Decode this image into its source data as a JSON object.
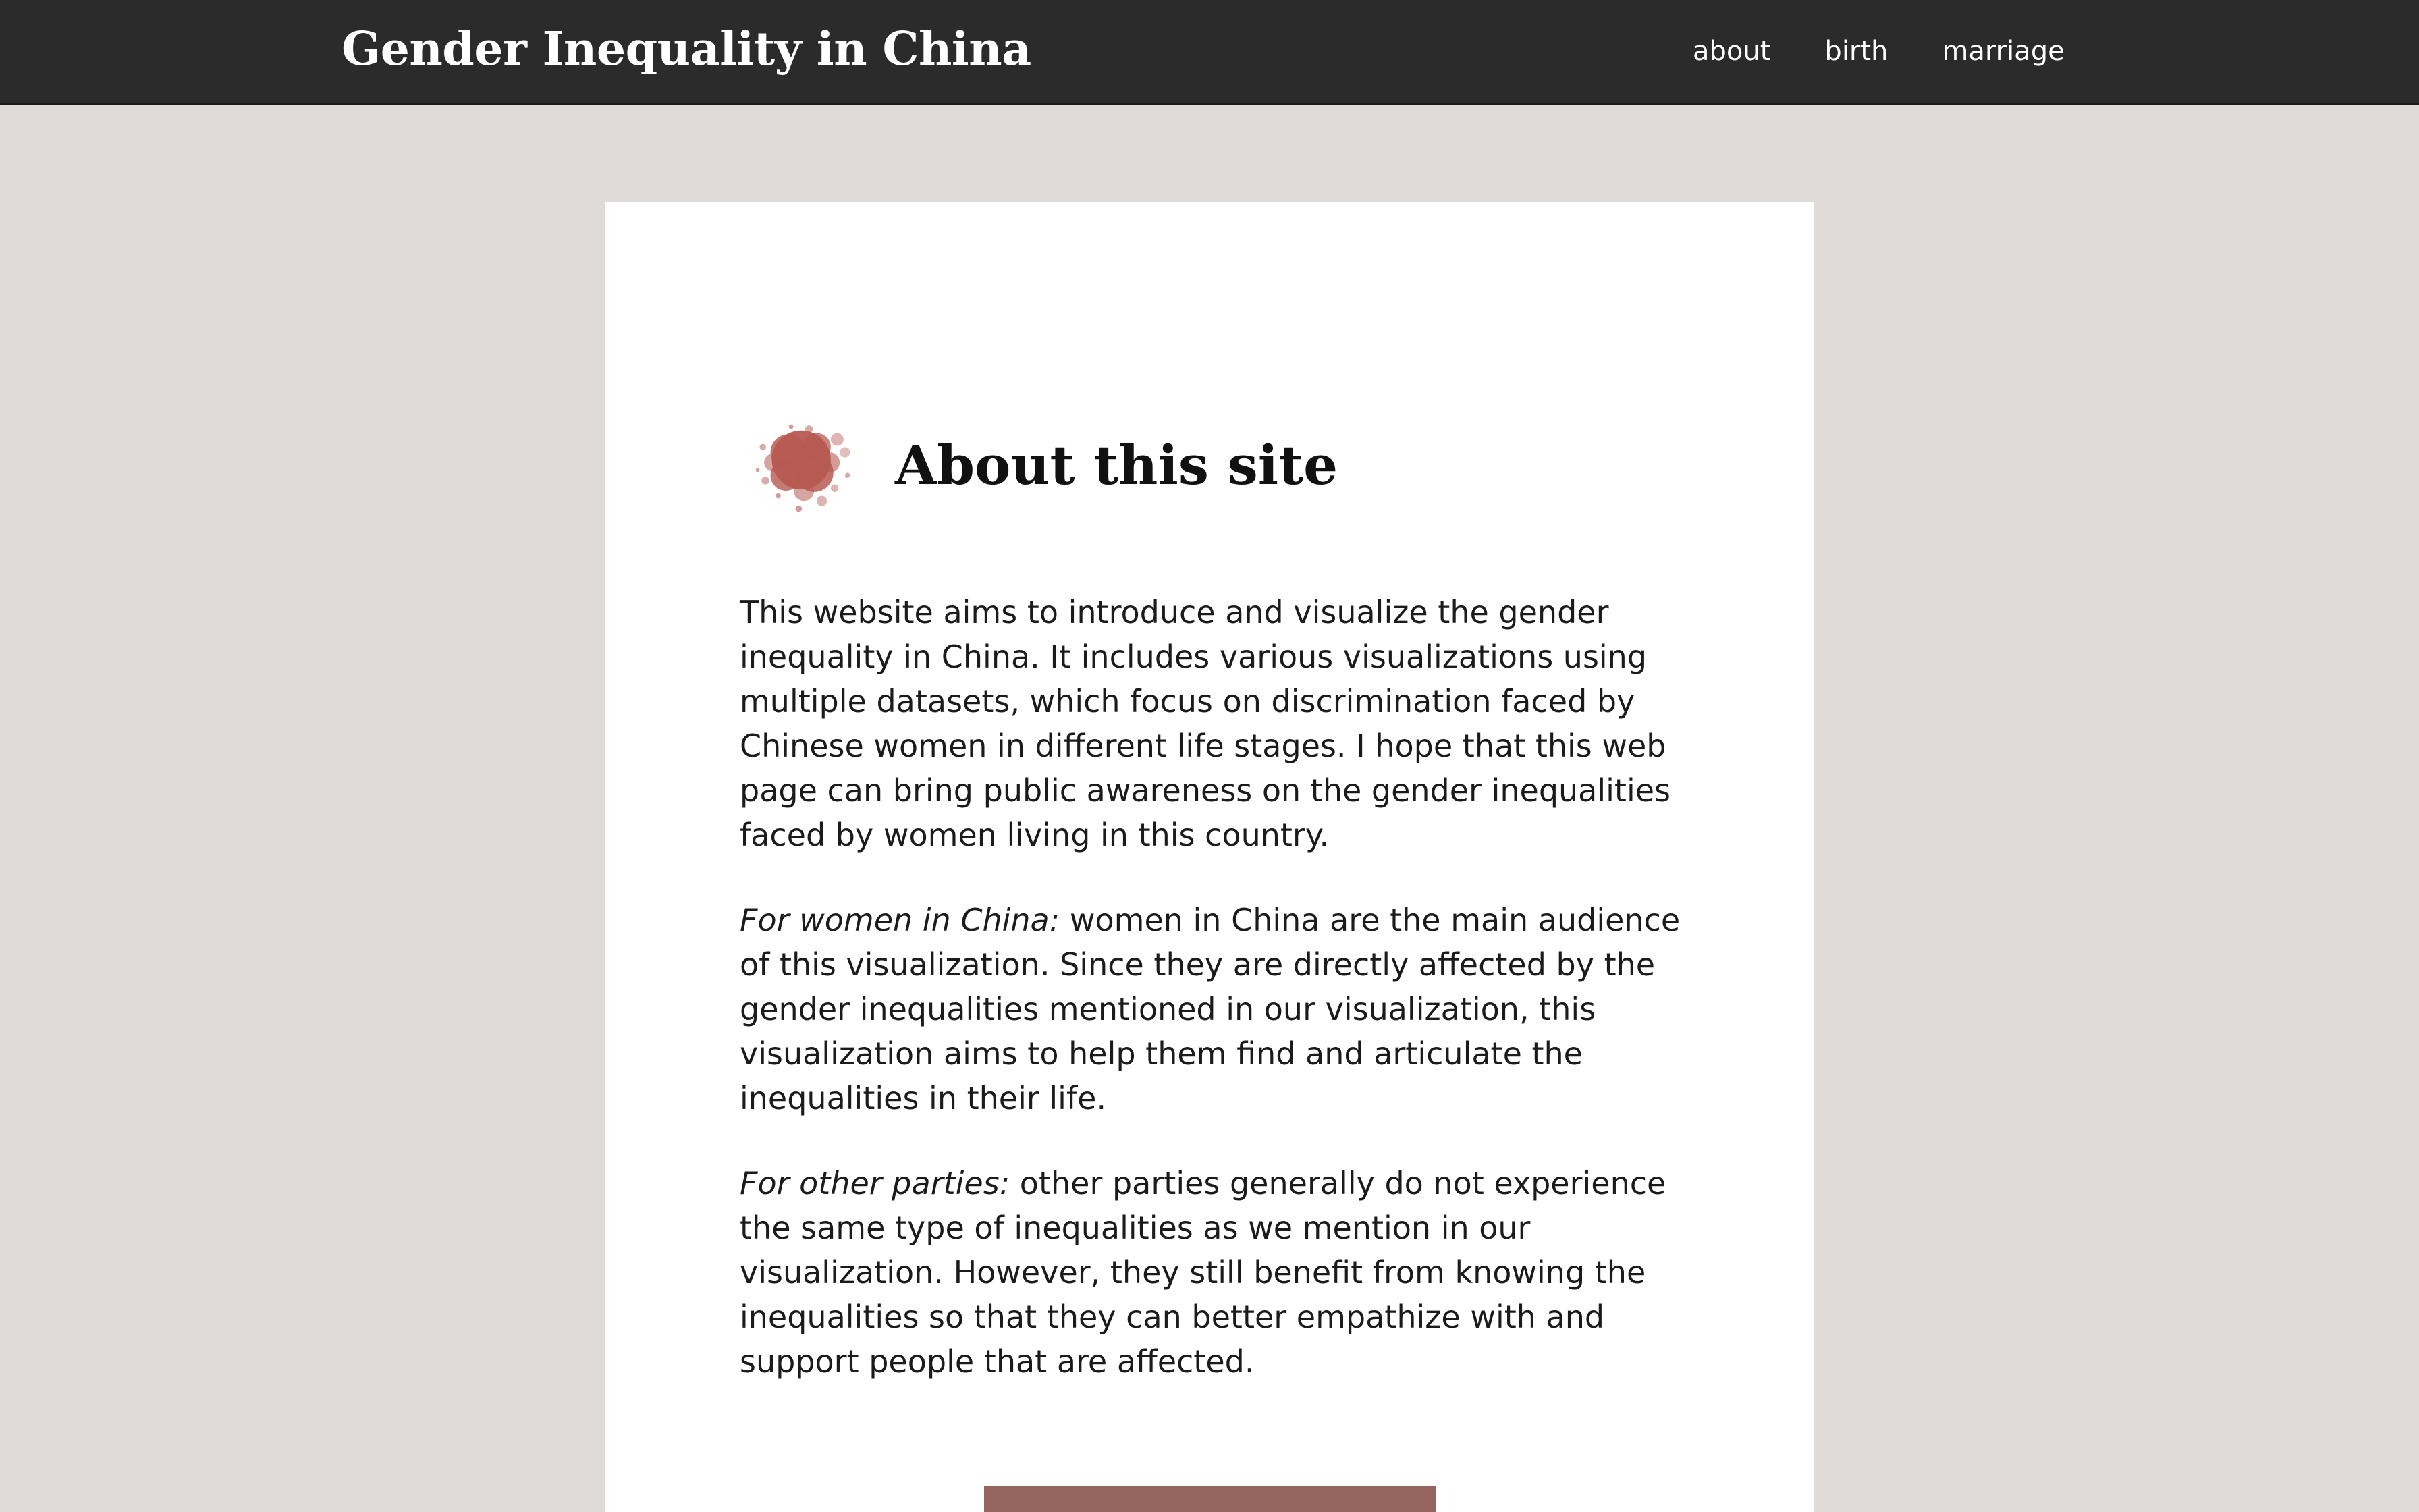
{
  "header": {
    "site_title": "Gender Inequality in China",
    "nav": [
      "about",
      "birth",
      "marriage"
    ]
  },
  "main": {
    "heading": "About this site",
    "heading_icon": "paint-splat-icon",
    "paragraphs": [
      {
        "lead": "",
        "text": "This website aims to introduce and visualize the gender inequality in China. It includes various visualizations using multiple datasets, which focus on discrimination faced by Chinese women in different life stages. I hope that this web page can bring public awareness on the gender inequalities faced by women living in this country."
      },
      {
        "lead": "For women in China:",
        "text": " women in China are the main audience of this visualization. Since they are directly affected by the gender inequalities mentioned in our visualization, this visualization aims to help them find and articulate the inequalities in their life."
      },
      {
        "lead": "For other parties:",
        "text": " other parties generally do not experience the same type of inequalities as we mention in our visualization. However, they still benefit from knowing the inequalities so that they can better empathize with and support people that are affected."
      }
    ]
  },
  "colors": {
    "topbar": "#2b2b2b",
    "page_bg": "#e0dbd9",
    "card_bg": "#ffffff",
    "accent": "#95645f",
    "splat": "#b65a52"
  }
}
